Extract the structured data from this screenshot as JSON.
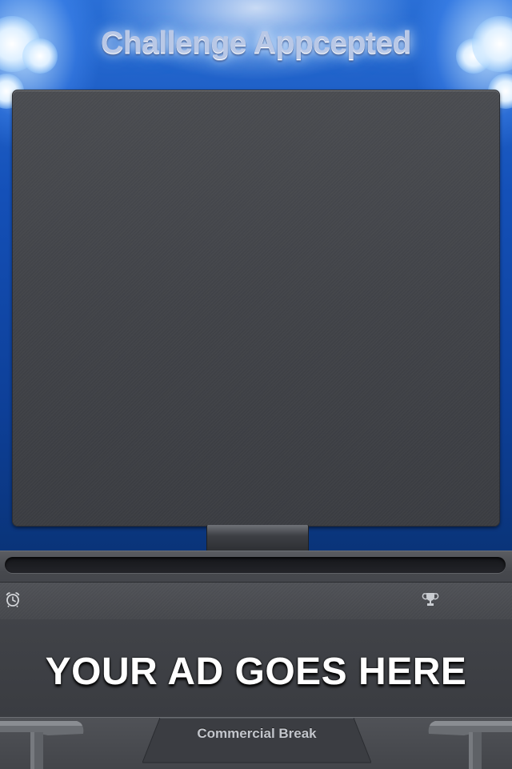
{
  "app": {
    "title": "Challenge Appcepted"
  },
  "console": {
    "progress": 0,
    "timer_icon": "alarm-clock-icon",
    "trophy_icon": "trophy-icon"
  },
  "ad": {
    "text": "YOUR AD GOES HERE"
  },
  "bottom_bar": {
    "tab_label": "Commercial Break"
  },
  "colors": {
    "background_blue": "#1450b8",
    "board": "#414348",
    "panel": "#46484d"
  }
}
